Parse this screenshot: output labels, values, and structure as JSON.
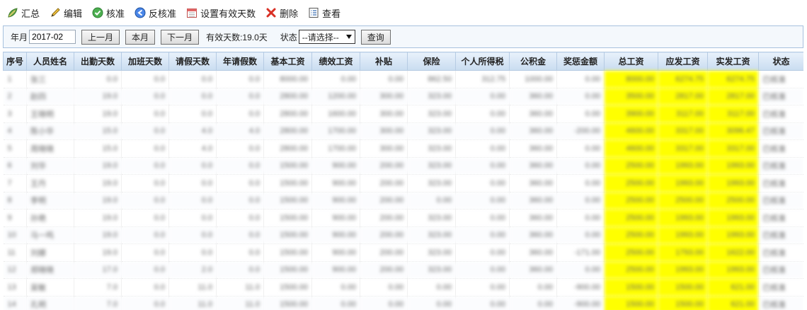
{
  "toolbar": {
    "summary": "汇总",
    "edit": "编辑",
    "approve": "核准",
    "unapprove": "反核准",
    "set_valid_days": "设置有效天数",
    "delete": "删除",
    "view": "查看"
  },
  "filter": {
    "month_label": "年月",
    "month_value": "2017-02",
    "prev_month": "上一月",
    "this_month": "本月",
    "next_month": "下一月",
    "valid_days": "有效天数:19.0天",
    "status_label": "状态",
    "status_selected": "--请选择--",
    "query": "查询"
  },
  "table": {
    "headers": [
      "序号",
      "人员姓名",
      "出勤天数",
      "加班天数",
      "请假天数",
      "年请假数",
      "基本工资",
      "绩效工资",
      "补贴",
      "保险",
      "个人所得税",
      "公积金",
      "奖惩金额",
      "总工资",
      "应发工资",
      "实发工资",
      "状态"
    ],
    "rows": [
      [
        "1",
        "张三",
        "0.0",
        "0.0",
        "0.0",
        "0.0",
        "8000.00",
        "0.00",
        "0.00",
        "862.50",
        "312.75",
        "1000.00",
        "0.00",
        "8000.00",
        "6274.75",
        "6274.75",
        "已核准"
      ],
      [
        "2",
        "赵四",
        "19.0",
        "0.0",
        "0.0",
        "0.0",
        "2800.00",
        "1200.00",
        "300.00",
        "323.00",
        "0.00",
        "360.00",
        "0.00",
        "3500.00",
        "2817.00",
        "2817.00",
        "已核准"
      ],
      [
        "3",
        "王晓明",
        "19.0",
        "0.0",
        "0.0",
        "0.0",
        "2800.00",
        "1600.00",
        "300.00",
        "323.00",
        "0.00",
        "360.00",
        "0.00",
        "3900.00",
        "3117.00",
        "3117.00",
        "已核准"
      ],
      [
        "4",
        "陈小华",
        "15.0",
        "0.0",
        "4.0",
        "4.0",
        "2800.00",
        "1700.00",
        "300.00",
        "323.00",
        "0.00",
        "360.00",
        "-200.00",
        "4600.00",
        "3317.00",
        "3096.47",
        "已核准"
      ],
      [
        "5",
        "周晓晓",
        "15.0",
        "0.0",
        "4.0",
        "0.0",
        "2800.00",
        "1700.00",
        "300.00",
        "323.00",
        "0.00",
        "360.00",
        "0.00",
        "4600.00",
        "3317.00",
        "3317.00",
        "已核准"
      ],
      [
        "6",
        "刘华",
        "19.0",
        "0.0",
        "0.0",
        "0.0",
        "1500.00",
        "900.00",
        "200.00",
        "323.00",
        "0.00",
        "360.00",
        "0.00",
        "2500.00",
        "1993.00",
        "1993.00",
        "已核准"
      ],
      [
        "7",
        "王丹",
        "19.0",
        "0.0",
        "0.0",
        "0.0",
        "1500.00",
        "900.00",
        "200.00",
        "323.00",
        "0.00",
        "360.00",
        "0.00",
        "2500.00",
        "1993.00",
        "1993.00",
        "已核准"
      ],
      [
        "8",
        "李明",
        "19.0",
        "0.0",
        "0.0",
        "0.0",
        "1500.00",
        "900.00",
        "200.00",
        "0.00",
        "0.00",
        "360.00",
        "0.00",
        "2500.00",
        "2500.00",
        "2500.00",
        "已核准"
      ],
      [
        "9",
        "孙艳",
        "19.0",
        "0.0",
        "0.0",
        "0.0",
        "1500.00",
        "900.00",
        "200.00",
        "323.00",
        "0.00",
        "360.00",
        "0.00",
        "2500.00",
        "1993.00",
        "1993.00",
        "已核准"
      ],
      [
        "10",
        "马一鸣",
        "19.0",
        "0.0",
        "0.0",
        "0.0",
        "1500.00",
        "900.00",
        "200.00",
        "323.00",
        "0.00",
        "360.00",
        "0.00",
        "2500.00",
        "1993.00",
        "1993.00",
        "已核准"
      ],
      [
        "11",
        "刘娜",
        "19.0",
        "0.0",
        "0.0",
        "0.0",
        "1500.00",
        "900.00",
        "200.00",
        "323.00",
        "0.00",
        "360.00",
        "-171.00",
        "2500.00",
        "1793.00",
        "1622.00",
        "已核准"
      ],
      [
        "12",
        "郑晓晓",
        "17.0",
        "0.0",
        "2.0",
        "0.0",
        "1500.00",
        "900.00",
        "200.00",
        "323.00",
        "0.00",
        "360.00",
        "0.00",
        "2500.00",
        "1993.00",
        "1993.00",
        "已核准"
      ],
      [
        "13",
        "吴敏",
        "7.0",
        "0.0",
        "11.0",
        "11.0",
        "1500.00",
        "0.00",
        "0.00",
        "0.00",
        "0.00",
        "0.00",
        "-900.00",
        "1500.00",
        "1500.00",
        "621.00",
        "已核准"
      ],
      [
        "14",
        "孔明",
        "7.0",
        "0.0",
        "11.0",
        "11.0",
        "1500.00",
        "0.00",
        "0.00",
        "0.00",
        "0.00",
        "0.00",
        "-900.00",
        "1500.00",
        "1500.00",
        "621.00",
        "已核准"
      ]
    ]
  },
  "colors": {
    "highlight": "#ffff00",
    "header_bg": "#c9dcf0",
    "filter_border": "#a7c1de"
  },
  "icons": [
    "leaf-summary-icon",
    "pencil-icon",
    "check-circle-icon",
    "back-arrow-circle-icon",
    "calendar-icon",
    "red-x-icon",
    "list-icon",
    "dropdown-triangle-icon"
  ]
}
